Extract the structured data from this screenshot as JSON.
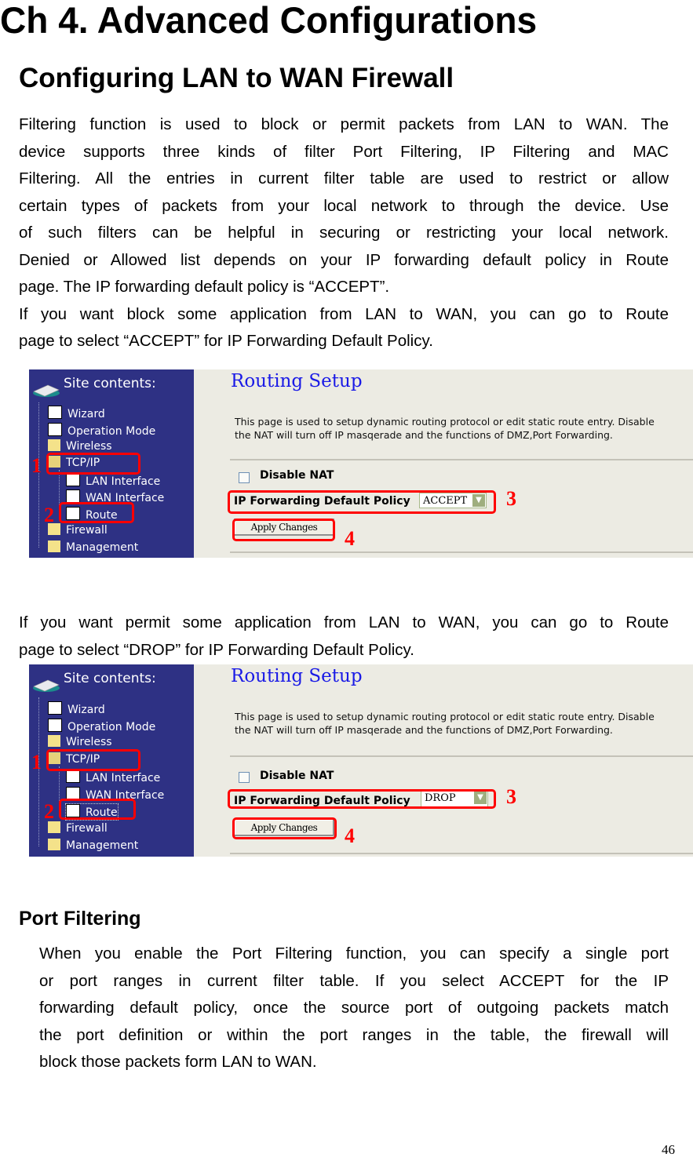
{
  "chapter_title": "Ch 4. Advanced Configurations",
  "section_title": "Configuring LAN to WAN Firewall",
  "intro_lines": [
    "Filtering function is used to block or permit packets from LAN to WAN. The",
    "device supports three kinds of filter Port Filtering, IP Filtering and MAC",
    "Filtering. All the entries in current filter table are used to restrict or allow",
    "certain types of packets from your local network to through the device. Use",
    "of such filters can be helpful in securing or restricting your local network.",
    "Denied or Allowed list depends on your IP forwarding default policy in Route",
    "page. The IP forwarding default policy is “ACCEPT”.",
    "If you want block some application from LAN to WAN, you can go to Route",
    "page to select “ACCEPT” for IP Forwarding Default Policy."
  ],
  "permit_lines": [
    "If you want permit some application from LAN to WAN, you can go to Route",
    "page to select “DROP” for IP Forwarding Default Policy."
  ],
  "screenshots": [
    {
      "sidebar_title": "Site contents:",
      "tree": [
        "Wizard",
        "Operation Mode",
        "Wireless",
        "TCP/IP",
        "LAN Interface",
        "WAN Interface",
        "Route",
        "Firewall",
        "Management"
      ],
      "page_title": "Routing Setup",
      "desc_lines": [
        "This page is used to setup dynamic routing protocol or edit static route entry. Disable",
        "the NAT will turn off IP masqerade and the functions of DMZ,Port Forwarding."
      ],
      "disable_nat_label": "Disable NAT",
      "ipfw_label": "IP Forwarding Default Policy",
      "policy_value": "ACCEPT",
      "apply_label": "Apply Changes",
      "markers": [
        "1",
        "2",
        "3",
        "4"
      ]
    },
    {
      "sidebar_title": "Site contents:",
      "tree": [
        "Wizard",
        "Operation Mode",
        "Wireless",
        "TCP/IP",
        "LAN Interface",
        "WAN Interface",
        "Route",
        "Firewall",
        "Management"
      ],
      "page_title": "Routing Setup",
      "desc_lines": [
        "This page is used to setup dynamic routing protocol or edit static route entry. Disable",
        "the NAT will turn off IP masqerade and the functions of DMZ,Port Forwarding."
      ],
      "disable_nat_label": "Disable NAT",
      "ipfw_label": "IP Forwarding Default Policy",
      "policy_value": "DROP",
      "apply_label": "Apply Changes",
      "markers": [
        "1",
        "2",
        "3",
        "4"
      ]
    }
  ],
  "port_filtering": {
    "title": "Port Filtering",
    "lines": [
      "When you enable the Port Filtering function, you can specify a single port",
      "or port ranges in current filter table. If you select ACCEPT for the IP",
      "forwarding default policy, once the source port of outgoing packets match",
      "the port definition or within the port ranges in the table, the firewall will",
      "block those packets form LAN to WAN."
    ]
  },
  "page_number": "46",
  "colors": {
    "sidebar_bg": "#2e3184",
    "content_bg": "#ecebe3",
    "routing_title": "#1a1ae6",
    "annotation_red": "#ff0000"
  }
}
